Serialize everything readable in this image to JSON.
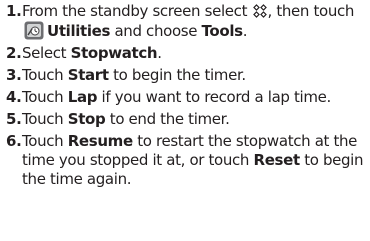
{
  "steps": [
    {
      "number": "1.",
      "parts": {
        "t1": "From the standby screen select",
        "t2": ", then touch",
        "b1": "Utilities",
        "t3": "and choose",
        "b2": "Tools",
        "t4": "."
      }
    },
    {
      "number": "2.",
      "parts": {
        "t1": "Select",
        "b1": "Stopwatch",
        "t2": "."
      }
    },
    {
      "number": "3.",
      "parts": {
        "t1": "Touch",
        "b1": "Start",
        "t2": "to begin the timer."
      }
    },
    {
      "number": "4.",
      "parts": {
        "t1": "Touch",
        "b1": "Lap",
        "t2": "if you want to record a lap time."
      }
    },
    {
      "number": "5.",
      "parts": {
        "t1": "Touch",
        "b1": "Stop",
        "t2": "to end the timer."
      }
    },
    {
      "number": "6.",
      "parts": {
        "t1": "Touch",
        "b1": "Resume",
        "t2": "to restart the stopwatch at the time you stopped it at, or touch",
        "b2": "Reset",
        "t3": "to begin the time again."
      }
    }
  ],
  "icons": {
    "menu": "menu-grid-icon",
    "utilities": "utilities-app-icon"
  },
  "colors": {
    "text": "#231f20",
    "icon_gray": "#6d6e71"
  }
}
